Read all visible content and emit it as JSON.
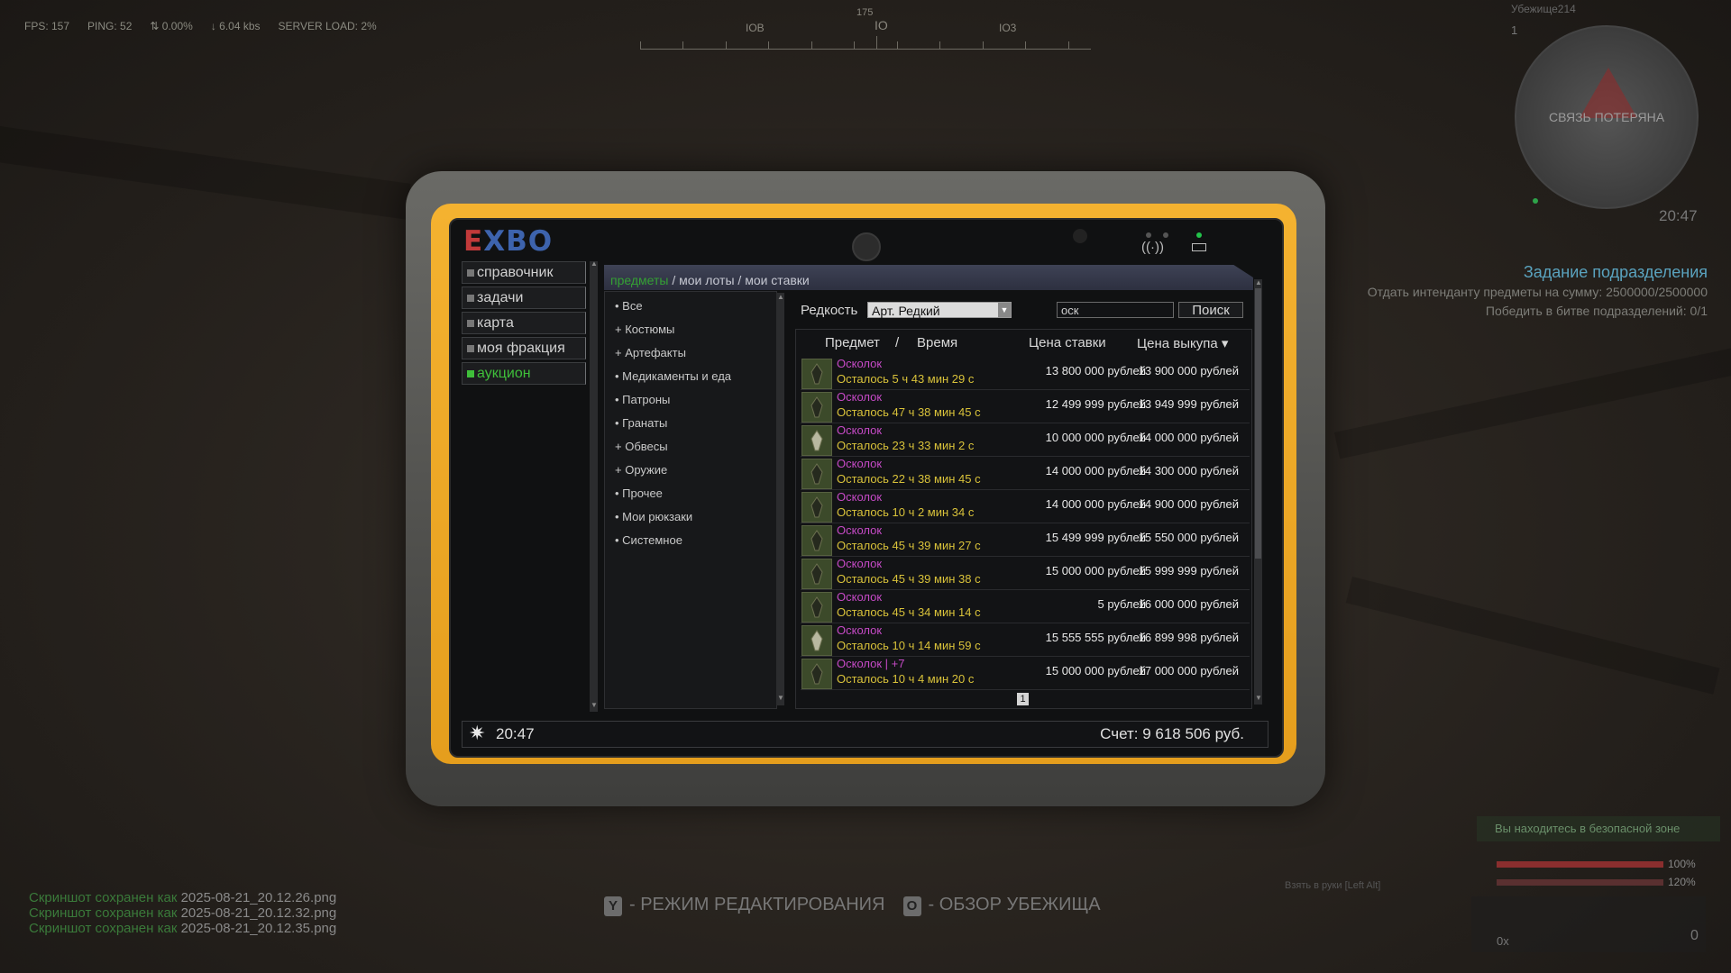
{
  "hud": {
    "fps": "FPS: 157",
    "ping": "PING: 52",
    "loss": "0.00%",
    "bandwidth": "6.04 kbs",
    "server_load": "SERVER LOAD: 2%"
  },
  "compass": {
    "heading": "175",
    "labels": [
      "IOB",
      "IO",
      "IO3"
    ]
  },
  "minimap": {
    "player": "Убежище214",
    "level": "1",
    "status": "СВЯЗЬ ПОТЕРЯНА",
    "time": "20:47"
  },
  "quest": {
    "title": "Задание подразделения",
    "lines": [
      "Отдать интенданту предметы на сумму: 2500000/2500000",
      "Победить в битве подразделений: 0/1"
    ]
  },
  "status": {
    "safe_zone": "Вы находитесь в безопасной зоне",
    "health_pct": "100%",
    "health_value": 1.0,
    "stamina_pct": "120%",
    "stamina_value": 1.0,
    "weapon_hint": "Взять в руки [Left Alt]",
    "ammo": "0x",
    "count": "0"
  },
  "screenshots": [
    {
      "prefix": "Скриншот сохранен как ",
      "file": "2025-08-21_20.12.26.png"
    },
    {
      "prefix": "Скриншот сохранен как ",
      "file": "2025-08-21_20.12.32.png"
    },
    {
      "prefix": "Скриншот сохранен как ",
      "file": "2025-08-21_20.12.35.png"
    }
  ],
  "hints": {
    "edit_key": "Y",
    "edit_label": "- РЕЖИМ РЕДАКТИРОВАНИЯ",
    "overview_key": "O",
    "overview_label": "- ОБЗОР УБЕЖИЩА"
  },
  "tablet": {
    "logo_e": "E",
    "logo_rest": "XBO",
    "nav": [
      {
        "label": "справочник",
        "active": false
      },
      {
        "label": "задачи",
        "active": false
      },
      {
        "label": "карта",
        "active": false
      },
      {
        "label": "моя фракция",
        "active": false
      },
      {
        "label": "аукцион",
        "active": true
      }
    ],
    "breadcrumb": {
      "current": "предметы",
      "sep1": " / ",
      "lots": "мои лоты",
      "sep2": " / ",
      "bids": "мои ставки"
    },
    "categories": [
      "• Все",
      "+ Костюмы",
      "+ Артефакты",
      "• Медикаменты и еда",
      "• Патроны",
      "• Гранаты",
      "+ Обвесы",
      "+ Оружие",
      "• Прочее",
      "• Мои рюкзаки",
      "• Системное"
    ],
    "filter": {
      "rarity_label": "Редкость",
      "rarity_value": "Арт. Редкий",
      "search_value": "оск",
      "search_button": "Поиск"
    },
    "columns": {
      "item": "Предмет",
      "slash": "/",
      "time": "Время",
      "bid": "Цена ставки",
      "buyout": "Цена выкупа ▾"
    },
    "rows": [
      {
        "name": "Осколок",
        "time": "Осталось 5 ч 43 мин 29 с",
        "bid": "13 800 000 рублей",
        "buyout": "13 900 000 рублей",
        "icon": "shard-icon"
      },
      {
        "name": "Осколок",
        "time": "Осталось 47 ч 38 мин 45 с",
        "bid": "12 499 999 рублей",
        "buyout": "13 949 999 рублей",
        "icon": "shard-icon"
      },
      {
        "name": "Осколок",
        "time": "Осталось 23 ч 33 мин 2 с",
        "bid": "10 000 000 рублей",
        "buyout": "14 000 000 рублей",
        "icon": "shard-alt-icon"
      },
      {
        "name": "Осколок",
        "time": "Осталось 22 ч 38 мин 45 с",
        "bid": "14 000 000 рублей",
        "buyout": "14 300 000 рублей",
        "icon": "shard-icon"
      },
      {
        "name": "Осколок",
        "time": "Осталось 10 ч 2 мин 34 с",
        "bid": "14 000 000 рублей",
        "buyout": "14 900 000 рублей",
        "icon": "shard-icon"
      },
      {
        "name": "Осколок",
        "time": "Осталось 45 ч 39 мин 27 с",
        "bid": "15 499 999 рублей",
        "buyout": "15 550 000 рублей",
        "icon": "shard-icon"
      },
      {
        "name": "Осколок",
        "time": "Осталось 45 ч 39 мин 38 с",
        "bid": "15 000 000 рублей",
        "buyout": "15 999 999 рублей",
        "icon": "shard-icon"
      },
      {
        "name": "Осколок",
        "time": "Осталось 45 ч 34 мин 14 с",
        "bid": "5 рублей",
        "buyout": "16 000 000 рублей",
        "icon": "shard-icon"
      },
      {
        "name": "Осколок",
        "time": "Осталось 10 ч 14 мин 59 с",
        "bid": "15 555 555 рублей",
        "buyout": "16 899 998 рублей",
        "icon": "shard-alt-icon"
      },
      {
        "name": "Осколок | +7",
        "time": "Осталось 10 ч 4 мин 20 с",
        "bid": "15 000 000 рублей",
        "buyout": "17 000 000 рублей",
        "icon": "shard-icon"
      }
    ],
    "page": "1",
    "clock": "20:47",
    "account": "Счет: 9 618 506 руб."
  }
}
